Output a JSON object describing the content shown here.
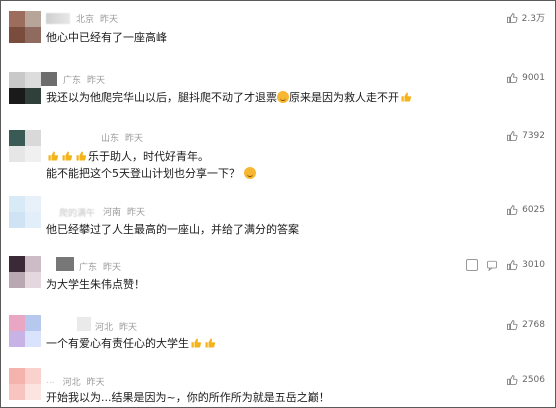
{
  "comments": [
    {
      "name": "赵月",
      "location": "北京",
      "time": "昨天",
      "likes": "2.3万",
      "text": "他心中已经有了一座高峰"
    },
    {
      "name": "",
      "location": "广东",
      "time": "昨天",
      "likes": "9001",
      "text_a": "我还以为他爬完华山以后，腿抖爬不动了才退票",
      "text_b": "原来是因为救人走不开"
    },
    {
      "name": "",
      "location": "山东",
      "time": "昨天",
      "likes": "7392",
      "text_line1": "乐于助人，时代好青年。",
      "text_line2": "能不能把这个5天登山计划也分享一下？"
    },
    {
      "name": "爬的满午",
      "location": "河南",
      "time": "昨天",
      "likes": "6025",
      "text": "他已经攀过了人生最高的一座山，并给了满分的答案"
    },
    {
      "name": "",
      "location": "广东",
      "time": "昨天",
      "likes": "3010",
      "text": "为大学生朱伟点赞！"
    },
    {
      "name": "",
      "location": "河北",
      "time": "昨天",
      "likes": "2768",
      "text": "一个有爱心有责任心的大学生"
    },
    {
      "name": "...",
      "location": "河北",
      "time": "昨天",
      "likes": "2506",
      "text": "开始我以为...结果是因为~，你的所作所为就是五岳之巅！"
    }
  ]
}
